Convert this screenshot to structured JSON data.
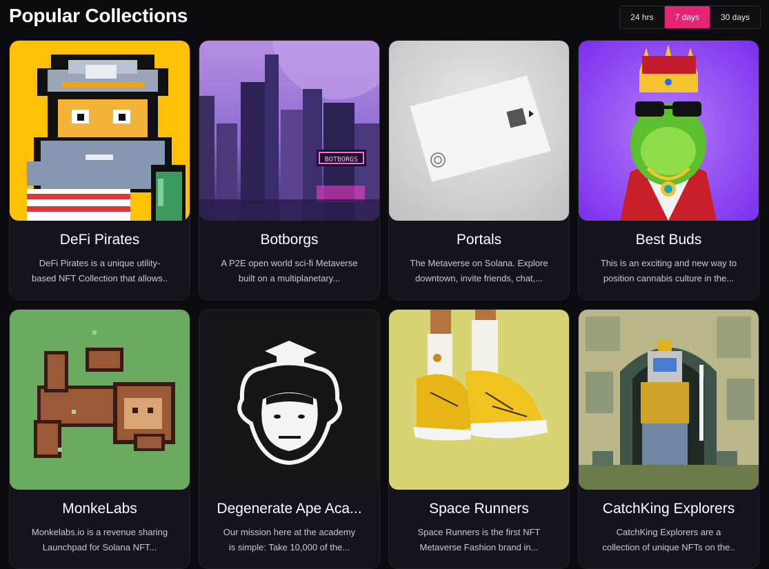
{
  "header": {
    "title": "Popular Collections",
    "ranges": [
      {
        "label": "24 hrs",
        "active": false
      },
      {
        "label": "7 days",
        "active": true
      },
      {
        "label": "30 days",
        "active": false
      }
    ]
  },
  "collections": [
    {
      "name": "DeFi Pirates",
      "description": "DeFi Pirates is a unique utility-based NFT Collection that allows..",
      "image": "pixel-pirate"
    },
    {
      "name": "Botborgs",
      "description": "A P2E open world sci-fi Metaverse built on a multiplanetary...",
      "image": "sci-fi-city"
    },
    {
      "name": "Portals",
      "description": "The Metaverse on Solana. Explore downtown, invite friends, chat,...",
      "image": "white-card"
    },
    {
      "name": "Best Buds",
      "description": "This is an exciting and new way to position cannabis culture in the...",
      "image": "crowned-bud"
    },
    {
      "name": "MonkeLabs",
      "description": "Monkelabs.io is a revenue sharing Launchpad for Solana NFT...",
      "image": "pixel-monkey"
    },
    {
      "name": "Degenerate Ape Aca...",
      "description": "Our mission here at the academy is simple: Take 10,000 of the...",
      "image": "ape-logo"
    },
    {
      "name": "Space Runners",
      "description": "Space Runners is the first NFT Metaverse Fashion brand in...",
      "image": "gold-sneakers"
    },
    {
      "name": "CatchKing Explorers",
      "description": "CatchKing Explorers are a collection of unique NFTs on the..",
      "image": "pixel-explorer"
    }
  ],
  "colors": {
    "accent": "#e42575",
    "background": "#0b0b10",
    "card": "#15131c"
  }
}
